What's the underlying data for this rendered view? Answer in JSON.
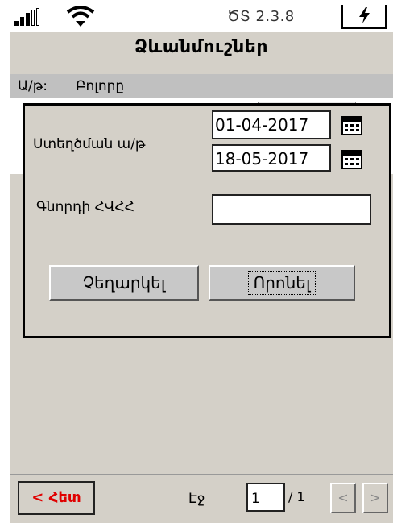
{
  "status": {
    "version": "ԾՏ 2.3.8",
    "icons": [
      "signal-icon",
      "wifi-icon",
      "battery-charging-icon"
    ]
  },
  "header": {
    "title": "Ձևանմուշներ"
  },
  "filter": {
    "label": "Ա/թ:",
    "value": "Բոլորը"
  },
  "dialog": {
    "creation_date_label": "Ստեղծման ա/թ",
    "date_from": "01-04-2017",
    "date_to": "18-05-2017",
    "partner_tin_label": "Գնորդի ՀՎՀՀ",
    "partner_tin_value": "",
    "cancel_label": "Չեղարկել",
    "search_label": "Որոնել"
  },
  "footer": {
    "back_label": "< Հետ",
    "page_label": "Էջ",
    "page_value": "1",
    "page_total": "/ 1",
    "prev_label": "<",
    "next_label": ">"
  },
  "colors": {
    "back_text": "#e00000",
    "background": "#d4d0c8"
  }
}
